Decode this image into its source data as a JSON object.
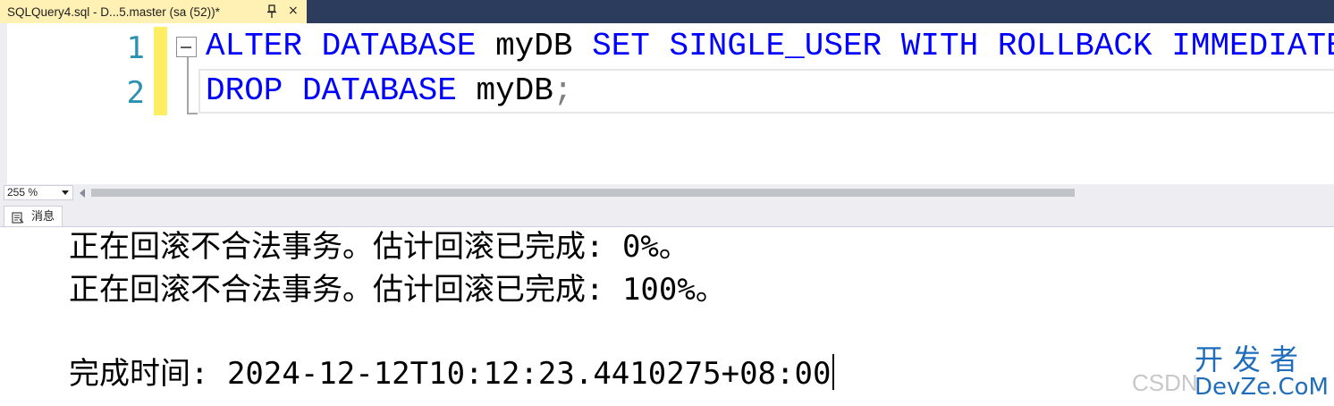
{
  "tab": {
    "title": "SQLQuery4.sql - D...5.master (sa (52))*",
    "close_glyph": "×"
  },
  "editor": {
    "line_numbers": [
      "1",
      "2"
    ],
    "lines": [
      {
        "tokens": [
          {
            "text": "ALTER",
            "kind": "kw"
          },
          {
            "text": " ",
            "kind": "id"
          },
          {
            "text": "DATABASE",
            "kind": "kw"
          },
          {
            "text": " myDB ",
            "kind": "id"
          },
          {
            "text": "SET",
            "kind": "kw"
          },
          {
            "text": " ",
            "kind": "id"
          },
          {
            "text": "SINGLE_USER",
            "kind": "kw"
          },
          {
            "text": " ",
            "kind": "id"
          },
          {
            "text": "WITH",
            "kind": "kw"
          },
          {
            "text": " ",
            "kind": "id"
          },
          {
            "text": "ROLLBACK",
            "kind": "kw"
          },
          {
            "text": " ",
            "kind": "id"
          },
          {
            "text": "IMMEDIATE",
            "kind": "kw"
          },
          {
            "text": ";",
            "kind": "pn"
          }
        ]
      },
      {
        "tokens": [
          {
            "text": "DROP",
            "kind": "kw"
          },
          {
            "text": " ",
            "kind": "id"
          },
          {
            "text": "DATABASE",
            "kind": "kw"
          },
          {
            "text": " myDB",
            "kind": "id"
          },
          {
            "text": ";",
            "kind": "pn"
          }
        ]
      }
    ]
  },
  "zoom": {
    "value": "255 %"
  },
  "results": {
    "messages_tab_label": "消息",
    "lines": [
      "正在回滚不合法事务。估计回滚已完成: 0%。",
      "正在回滚不合法事务。估计回滚已完成: 100%。",
      "完成时间: 2024-12-12T10:12:23.4410275+08:00"
    ]
  },
  "watermark": {
    "csdn": "CSDN",
    "cn": "开发者",
    "en": "DevZe.CoM"
  },
  "colors": {
    "keyword": "#0000ff",
    "identifier": "#000000",
    "punctuation": "#808080",
    "line_number": "#2b91af",
    "tab_active": "#fff0b3",
    "tabbar_bg": "#2b3c5d",
    "change_bar": "#ffee62"
  }
}
